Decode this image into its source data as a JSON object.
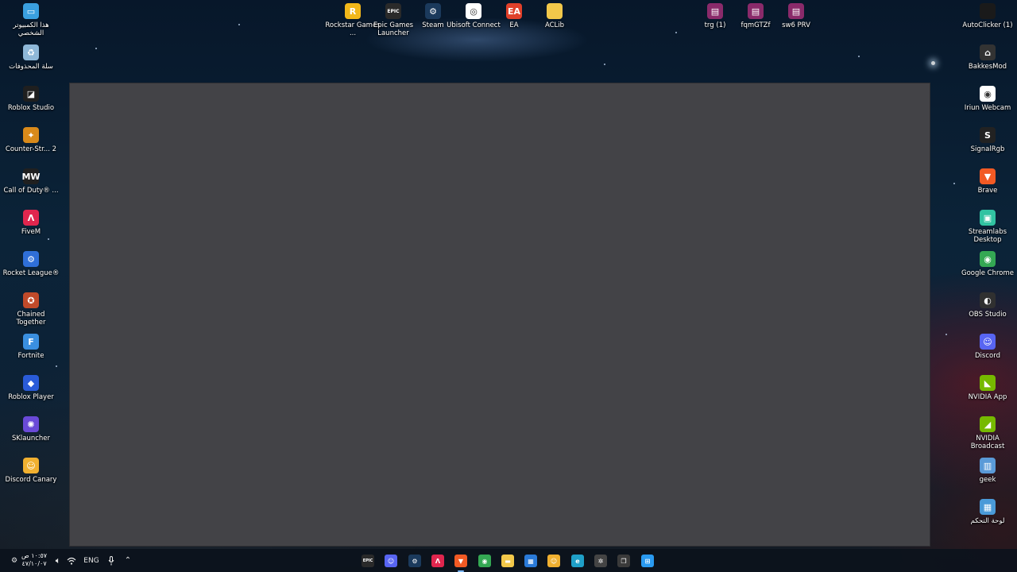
{
  "desktop": {
    "left_icons": [
      {
        "label": "هذا الكمبيوتر الشخصي",
        "icon": "computer-icon",
        "color": "#3aa0e0",
        "glyph": "▭"
      },
      {
        "label": "سلة المحذوفات",
        "icon": "recycle-bin-icon",
        "color": "#8fb8d8",
        "glyph": "♻"
      },
      {
        "label": "Roblox Studio",
        "icon": "roblox-studio-icon",
        "color": "#1f1f1f",
        "glyph": "◪"
      },
      {
        "label": "Counter-Str... 2",
        "icon": "counter-strike-icon",
        "color": "#d98a1a",
        "glyph": "✦"
      },
      {
        "label": "Call of Duty® ...",
        "icon": "call-of-duty-icon",
        "color": "#202020",
        "glyph": "MW"
      },
      {
        "label": "FiveM",
        "icon": "fivem-icon",
        "color": "#e0264e",
        "glyph": "Λ"
      },
      {
        "label": "Rocket League®",
        "icon": "rocket-league-icon",
        "color": "#2f6fd8",
        "glyph": "⚙"
      },
      {
        "label": "Chained Together",
        "icon": "chained-together-icon",
        "color": "#c04a2a",
        "glyph": "✪"
      },
      {
        "label": "Fortnite",
        "icon": "fortnite-icon",
        "color": "#3a8fe0",
        "glyph": "F"
      },
      {
        "label": "Roblox Player",
        "icon": "roblox-player-icon",
        "color": "#2a5bd8",
        "glyph": "◆"
      },
      {
        "label": "SKlauncher",
        "icon": "sklauncher-icon",
        "color": "#6a4ad8",
        "glyph": "✺"
      },
      {
        "label": "Discord Canary",
        "icon": "discord-canary-icon",
        "color": "#f0b030",
        "glyph": "☺"
      }
    ],
    "top_icons": [
      {
        "label": "Rockstar Games ...",
        "icon": "rockstar-games-icon",
        "color": "#f2b81a",
        "glyph": "R"
      },
      {
        "label": "Epic Games Launcher",
        "icon": "epic-games-icon",
        "color": "#2a2a2a",
        "glyph": "EPIC"
      },
      {
        "label": "Steam",
        "icon": "steam-icon",
        "color": "#1b3a5c",
        "glyph": "⚙"
      },
      {
        "label": "Ubisoft Connect",
        "icon": "ubisoft-connect-icon",
        "color": "#ffffff",
        "glyph": "◎"
      },
      {
        "label": "EA",
        "icon": "ea-icon",
        "color": "#e0402a",
        "glyph": "EA"
      },
      {
        "label": "ACLib",
        "icon": "folder-icon",
        "color": "#f2c84a",
        "glyph": ""
      }
    ],
    "top_right_icons": [
      {
        "label": "trg (1)",
        "icon": "winrar-archive-icon",
        "color": "#8a2a6a",
        "glyph": "▤"
      },
      {
        "label": "fqmGTZf",
        "icon": "winrar-archive-icon",
        "color": "#8a2a6a",
        "glyph": "▤"
      },
      {
        "label": "sw6 PRV",
        "icon": "winrar-archive-icon",
        "color": "#8a2a6a",
        "glyph": "▤"
      }
    ],
    "right_icons": [
      {
        "label": "AutoClicker (1)",
        "icon": "autoclicker-icon",
        "color": "#1a1a1a",
        "glyph": ""
      },
      {
        "label": "BakkesMod",
        "icon": "bakkesmod-icon",
        "color": "#333333",
        "glyph": "⌂"
      },
      {
        "label": "Iriun Webcam",
        "icon": "iriun-webcam-icon",
        "color": "#ffffff",
        "glyph": "◉"
      },
      {
        "label": "SignalRgb",
        "icon": "signalrgb-icon",
        "color": "#222222",
        "glyph": "S"
      },
      {
        "label": "Brave",
        "icon": "brave-icon",
        "color": "#f25a24",
        "glyph": "▼"
      },
      {
        "label": "Streamlabs Desktop",
        "icon": "streamlabs-icon",
        "color": "#31c3a2",
        "glyph": "▣"
      },
      {
        "label": "Google Chrome",
        "icon": "chrome-icon",
        "color": "#34a853",
        "glyph": "◉"
      },
      {
        "label": "OBS Studio",
        "icon": "obs-icon",
        "color": "#303030",
        "glyph": "◐"
      },
      {
        "label": "Discord",
        "icon": "discord-icon",
        "color": "#5865f2",
        "glyph": "☺"
      },
      {
        "label": "NVIDIA App",
        "icon": "nvidia-app-icon",
        "color": "#76b900",
        "glyph": "◣"
      },
      {
        "label": "NVIDIA Broadcast",
        "icon": "nvidia-broadcast-icon",
        "color": "#76b900",
        "glyph": "◢"
      },
      {
        "label": "geek",
        "icon": "geek-uninstaller-icon",
        "color": "#5a9ad8",
        "glyph": "▥"
      },
      {
        "label": "لوحة التحكم",
        "icon": "control-panel-icon",
        "color": "#4a9ad8",
        "glyph": "▦"
      }
    ]
  },
  "taskbar": {
    "clock_time": "١٠:٥٧ ص",
    "clock_date": "٤٧/١٠/٠٧",
    "language": "ENG",
    "apps": [
      {
        "name": "epic-games",
        "icon": "epic-games-icon",
        "color": "#2a2a2a",
        "glyph": "EPIC",
        "active": false
      },
      {
        "name": "discord",
        "icon": "discord-icon",
        "color": "#5865f2",
        "glyph": "☺",
        "active": false
      },
      {
        "name": "steam",
        "icon": "steam-icon",
        "color": "#1b3a5c",
        "glyph": "⚙",
        "active": false
      },
      {
        "name": "fivem",
        "icon": "fivem-icon",
        "color": "#e0264e",
        "glyph": "Λ",
        "active": false
      },
      {
        "name": "brave",
        "icon": "brave-icon",
        "color": "#f25a24",
        "glyph": "▼",
        "active": true
      },
      {
        "name": "chrome",
        "icon": "chrome-icon",
        "color": "#34a853",
        "glyph": "◉",
        "active": false
      },
      {
        "name": "file-explorer",
        "icon": "folder-icon",
        "color": "#f2c84a",
        "glyph": "▬",
        "active": false
      },
      {
        "name": "microsoft-store",
        "icon": "store-icon",
        "color": "#2a7ad8",
        "glyph": "▦",
        "active": false
      },
      {
        "name": "discord-canary",
        "icon": "discord-canary-icon",
        "color": "#f0b030",
        "glyph": "☺",
        "active": false
      },
      {
        "name": "edge",
        "icon": "edge-icon",
        "color": "#1fa0c8",
        "glyph": "e",
        "active": false
      },
      {
        "name": "steelseries",
        "icon": "steelseries-icon",
        "color": "#444444",
        "glyph": "✲",
        "active": false
      },
      {
        "name": "task-view",
        "icon": "task-view-icon",
        "color": "#3a3a3a",
        "glyph": "❐",
        "active": false
      },
      {
        "name": "start",
        "icon": "windows-start-icon",
        "color": "#2a9af0",
        "glyph": "⊞",
        "active": false
      }
    ]
  }
}
